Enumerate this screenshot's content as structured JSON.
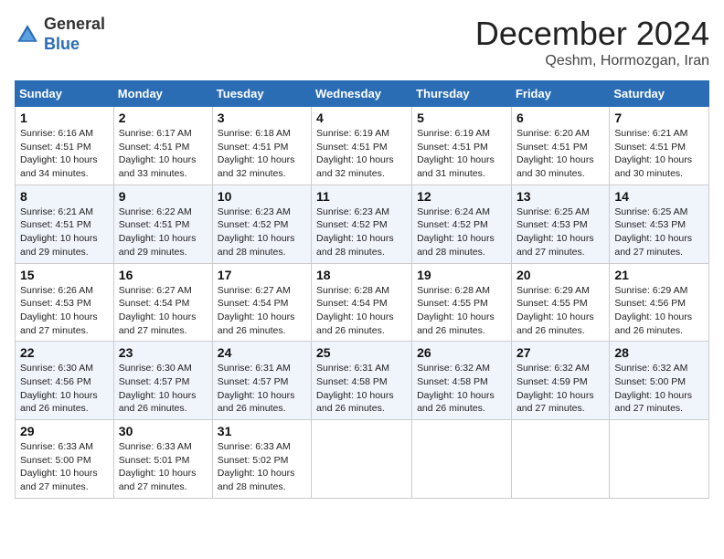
{
  "logo": {
    "general": "General",
    "blue": "Blue"
  },
  "header": {
    "month": "December 2024",
    "location": "Qeshm, Hormozgan, Iran"
  },
  "columns": [
    "Sunday",
    "Monday",
    "Tuesday",
    "Wednesday",
    "Thursday",
    "Friday",
    "Saturday"
  ],
  "weeks": [
    [
      {
        "day": "1",
        "info": "Sunrise: 6:16 AM\nSunset: 4:51 PM\nDaylight: 10 hours\nand 34 minutes."
      },
      {
        "day": "2",
        "info": "Sunrise: 6:17 AM\nSunset: 4:51 PM\nDaylight: 10 hours\nand 33 minutes."
      },
      {
        "day": "3",
        "info": "Sunrise: 6:18 AM\nSunset: 4:51 PM\nDaylight: 10 hours\nand 32 minutes."
      },
      {
        "day": "4",
        "info": "Sunrise: 6:19 AM\nSunset: 4:51 PM\nDaylight: 10 hours\nand 32 minutes."
      },
      {
        "day": "5",
        "info": "Sunrise: 6:19 AM\nSunset: 4:51 PM\nDaylight: 10 hours\nand 31 minutes."
      },
      {
        "day": "6",
        "info": "Sunrise: 6:20 AM\nSunset: 4:51 PM\nDaylight: 10 hours\nand 30 minutes."
      },
      {
        "day": "7",
        "info": "Sunrise: 6:21 AM\nSunset: 4:51 PM\nDaylight: 10 hours\nand 30 minutes."
      }
    ],
    [
      {
        "day": "8",
        "info": "Sunrise: 6:21 AM\nSunset: 4:51 PM\nDaylight: 10 hours\nand 29 minutes."
      },
      {
        "day": "9",
        "info": "Sunrise: 6:22 AM\nSunset: 4:51 PM\nDaylight: 10 hours\nand 29 minutes."
      },
      {
        "day": "10",
        "info": "Sunrise: 6:23 AM\nSunset: 4:52 PM\nDaylight: 10 hours\nand 28 minutes."
      },
      {
        "day": "11",
        "info": "Sunrise: 6:23 AM\nSunset: 4:52 PM\nDaylight: 10 hours\nand 28 minutes."
      },
      {
        "day": "12",
        "info": "Sunrise: 6:24 AM\nSunset: 4:52 PM\nDaylight: 10 hours\nand 28 minutes."
      },
      {
        "day": "13",
        "info": "Sunrise: 6:25 AM\nSunset: 4:53 PM\nDaylight: 10 hours\nand 27 minutes."
      },
      {
        "day": "14",
        "info": "Sunrise: 6:25 AM\nSunset: 4:53 PM\nDaylight: 10 hours\nand 27 minutes."
      }
    ],
    [
      {
        "day": "15",
        "info": "Sunrise: 6:26 AM\nSunset: 4:53 PM\nDaylight: 10 hours\nand 27 minutes."
      },
      {
        "day": "16",
        "info": "Sunrise: 6:27 AM\nSunset: 4:54 PM\nDaylight: 10 hours\nand 27 minutes."
      },
      {
        "day": "17",
        "info": "Sunrise: 6:27 AM\nSunset: 4:54 PM\nDaylight: 10 hours\nand 26 minutes."
      },
      {
        "day": "18",
        "info": "Sunrise: 6:28 AM\nSunset: 4:54 PM\nDaylight: 10 hours\nand 26 minutes."
      },
      {
        "day": "19",
        "info": "Sunrise: 6:28 AM\nSunset: 4:55 PM\nDaylight: 10 hours\nand 26 minutes."
      },
      {
        "day": "20",
        "info": "Sunrise: 6:29 AM\nSunset: 4:55 PM\nDaylight: 10 hours\nand 26 minutes."
      },
      {
        "day": "21",
        "info": "Sunrise: 6:29 AM\nSunset: 4:56 PM\nDaylight: 10 hours\nand 26 minutes."
      }
    ],
    [
      {
        "day": "22",
        "info": "Sunrise: 6:30 AM\nSunset: 4:56 PM\nDaylight: 10 hours\nand 26 minutes."
      },
      {
        "day": "23",
        "info": "Sunrise: 6:30 AM\nSunset: 4:57 PM\nDaylight: 10 hours\nand 26 minutes."
      },
      {
        "day": "24",
        "info": "Sunrise: 6:31 AM\nSunset: 4:57 PM\nDaylight: 10 hours\nand 26 minutes."
      },
      {
        "day": "25",
        "info": "Sunrise: 6:31 AM\nSunset: 4:58 PM\nDaylight: 10 hours\nand 26 minutes."
      },
      {
        "day": "26",
        "info": "Sunrise: 6:32 AM\nSunset: 4:58 PM\nDaylight: 10 hours\nand 26 minutes."
      },
      {
        "day": "27",
        "info": "Sunrise: 6:32 AM\nSunset: 4:59 PM\nDaylight: 10 hours\nand 27 minutes."
      },
      {
        "day": "28",
        "info": "Sunrise: 6:32 AM\nSunset: 5:00 PM\nDaylight: 10 hours\nand 27 minutes."
      }
    ],
    [
      {
        "day": "29",
        "info": "Sunrise: 6:33 AM\nSunset: 5:00 PM\nDaylight: 10 hours\nand 27 minutes."
      },
      {
        "day": "30",
        "info": "Sunrise: 6:33 AM\nSunset: 5:01 PM\nDaylight: 10 hours\nand 27 minutes."
      },
      {
        "day": "31",
        "info": "Sunrise: 6:33 AM\nSunset: 5:02 PM\nDaylight: 10 hours\nand 28 minutes."
      },
      null,
      null,
      null,
      null
    ]
  ]
}
